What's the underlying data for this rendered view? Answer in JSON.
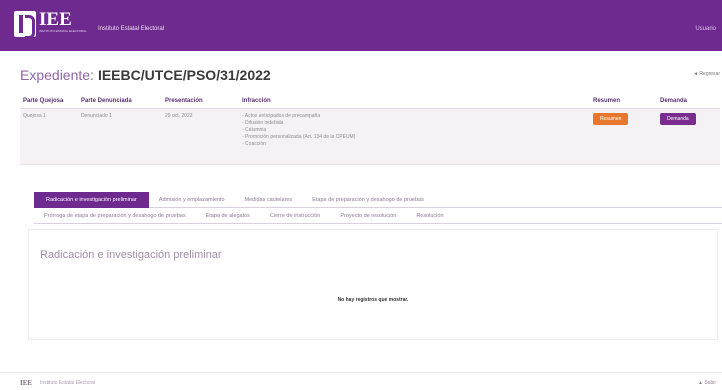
{
  "header": {
    "logo_text": "IEE",
    "logo_sub": "INSTITUTO ESTATAL ELECTORAL",
    "brand_name": "Instituto Estatal Electoral",
    "user_link": "Usuario"
  },
  "expediente": {
    "label": "Expediente:",
    "number": "IEEBC/UTCE/PSO/31/2022",
    "back_link": "◄ Regresar"
  },
  "table": {
    "headers": [
      "Parte Quejosa",
      "Parte Denunciada",
      "Presentación",
      "Infracción",
      "Resumen",
      "Demanda"
    ],
    "row": {
      "quejosa": "Quejosa 1",
      "denunciada": "Denunciado 1",
      "presentacion": "29 oct. 2022",
      "infracciones": [
        "- Actos anticipados de precampaña",
        "- Difusión indebida",
        "- Calumnia",
        "- Promoción personalizada (Art. 134 de la CPEUM)",
        "- Coacción"
      ],
      "resumen_label": "Resumen",
      "demanda_label": "Demanda"
    }
  },
  "tabs": {
    "row1": [
      "Radicación e investigación preliminar",
      "Admisión y emplazamiento",
      "Medidas cautelares",
      "Etapa de preparación y desahogo de pruebas"
    ],
    "row2": [
      "Prórroga de etapa de preparación y desahogo de pruebas",
      "Etapa de alegatos",
      "Cierre de instrucción",
      "Proyecto de resolución",
      "Resolución"
    ]
  },
  "panel": {
    "title": "Radicación e investigación preliminar",
    "empty_message": "No hay registros que mostrar."
  },
  "footer": {
    "logo_text": "IEE",
    "text": "Instituto Estatal Electoral",
    "link": "▲ Subir"
  },
  "colors": {
    "brand": "#6e2a8f",
    "resumen_button": "#e8772e",
    "demanda_button": "#7a2d8f"
  }
}
